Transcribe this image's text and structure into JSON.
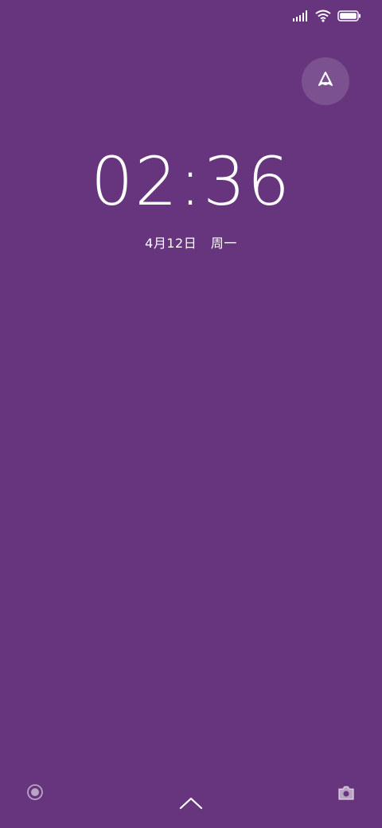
{
  "lockscreen": {
    "time": "02:36",
    "date": "4月12日",
    "weekday": "周一"
  },
  "status_bar": {
    "icons": [
      "signal-icon",
      "wifi-icon",
      "battery-icon"
    ],
    "battery_level": 1.0
  },
  "controls": {
    "assistant_icon": "assistant-icon",
    "left_icon": "record-icon",
    "center_icon": "chevron-up-icon",
    "right_icon": "camera-icon"
  },
  "colors": {
    "background": "#67357e",
    "foreground": "#ffffff"
  }
}
